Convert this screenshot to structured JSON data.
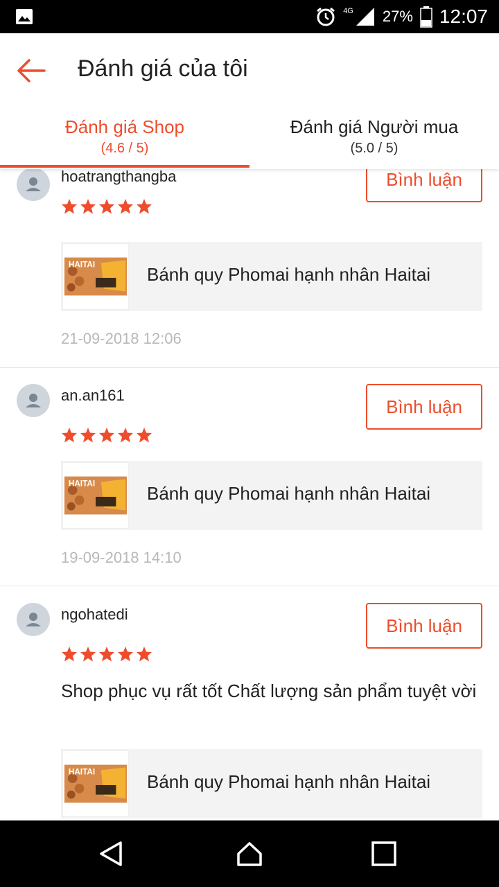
{
  "status_bar": {
    "network": "4G",
    "battery": "27%",
    "time": "12:07",
    "icons": [
      "image-icon",
      "alarm-icon",
      "signal-icon",
      "battery-icon"
    ]
  },
  "header": {
    "title": "Đánh giá của tôi",
    "back_icon": "arrow-left-icon"
  },
  "tabs": [
    {
      "label": "Đánh giá Shop",
      "score": "(4.6 / 5)",
      "active": true
    },
    {
      "label": "Đánh giá Người mua",
      "score": "(5.0 / 5)",
      "active": false
    }
  ],
  "reviews": [
    {
      "user": "hoatrangthangba",
      "rating": 5,
      "comment": "",
      "product": "Bánh quy Phomai hạnh nhân Haitai",
      "date": "21-09-2018 12:06",
      "reply_label": "Bình luận"
    },
    {
      "user": "an.an161",
      "rating": 5,
      "comment": "",
      "product": "Bánh quy Phomai hạnh nhân Haitai",
      "date": "19-09-2018 14:10",
      "reply_label": "Bình luận"
    },
    {
      "user": "ngohatedi",
      "rating": 5,
      "comment": "Shop phục vụ rất tốt Chất lượng sản phẩm tuyệt vời",
      "product": "Bánh quy Phomai hạnh nhân Haitai",
      "date": "",
      "reply_label": "Bình luận"
    }
  ],
  "thumbnail_text": "HAITAI",
  "colors": {
    "accent": "#ee4d2d",
    "star": "#ee4d2d",
    "date": "#b8b8b8",
    "product_bg": "#f3f3f3"
  },
  "nav_bar": [
    "back-triangle-icon",
    "home-icon",
    "recents-square-icon"
  ]
}
